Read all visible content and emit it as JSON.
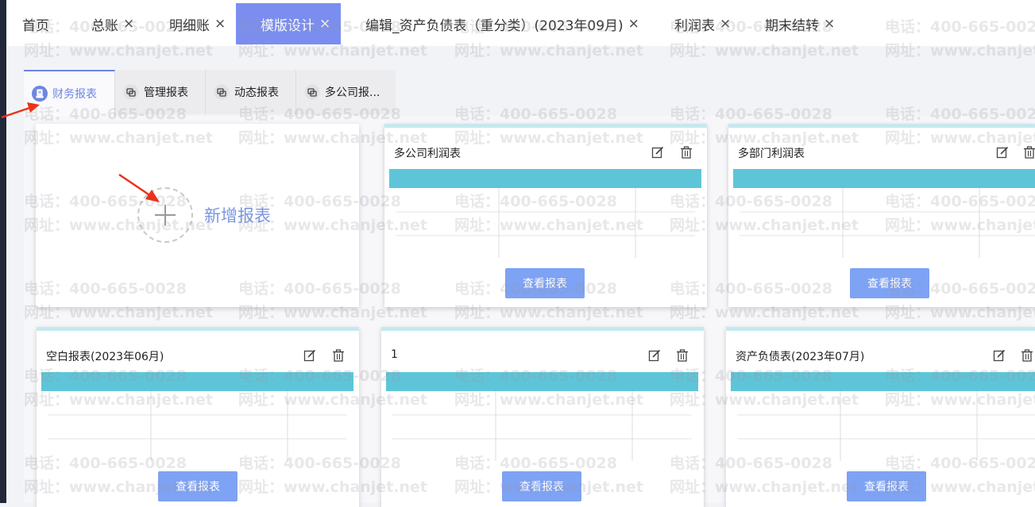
{
  "tabs": [
    {
      "label": "首页",
      "closable": false
    },
    {
      "label": "总账",
      "closable": true
    },
    {
      "label": "明细账",
      "closable": true
    },
    {
      "label": "模版设计",
      "closable": true,
      "active": true
    },
    {
      "label": "编辑_资产负债表（重分类）(2023年09月)",
      "closable": true
    },
    {
      "label": "利润表",
      "closable": true
    },
    {
      "label": "期末结转",
      "closable": true
    }
  ],
  "close_symbol": "×",
  "subtabs": [
    {
      "label": "财务报表",
      "icon": "finance-report-icon",
      "active": true
    },
    {
      "label": "管理报表",
      "icon": "chart-link-icon"
    },
    {
      "label": "动态报表",
      "icon": "chart-link-icon"
    },
    {
      "label": "多公司报...",
      "icon": "chart-link-icon"
    }
  ],
  "add_card": {
    "label": "新增报表",
    "icon": "plus-icon"
  },
  "cards": [
    {
      "name": "多公司利润表",
      "button": "查看报表"
    },
    {
      "name": "多部门利润表",
      "button": "查看报表"
    },
    {
      "name": "空白报表(2023年06月)",
      "button": "查看报表"
    },
    {
      "name": "1",
      "button": "查看报表"
    },
    {
      "name": "资产负债表(2023年07月)",
      "button": "查看报表"
    }
  ],
  "watermark": {
    "phone": "电话：400-665-0028",
    "site": "网址：www.chanjet.net"
  },
  "colors": {
    "active_tab": "#7b8ef0",
    "accent_blue": "#6e86e0",
    "card_bar": "#5ec5d8",
    "view_button": "#7ea2f4",
    "card_top_border": "#c5e9ef",
    "arrow": "#e8341c"
  }
}
